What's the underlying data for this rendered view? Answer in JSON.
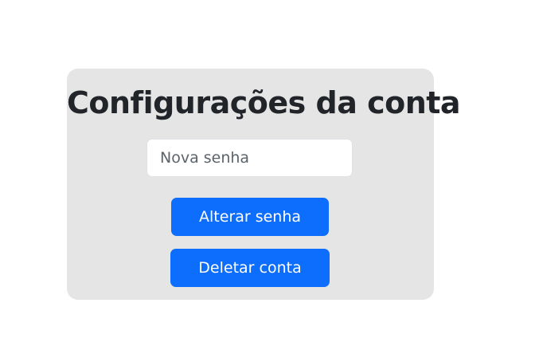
{
  "settings": {
    "title": "Configurações da conta",
    "password_input": {
      "placeholder": "Nova senha",
      "value": ""
    },
    "change_password_label": "Alterar senha",
    "delete_account_label": "Deletar conta"
  },
  "colors": {
    "card_background": "#e5e5e5",
    "primary_button": "#0d6efd",
    "title_text": "#212529"
  }
}
